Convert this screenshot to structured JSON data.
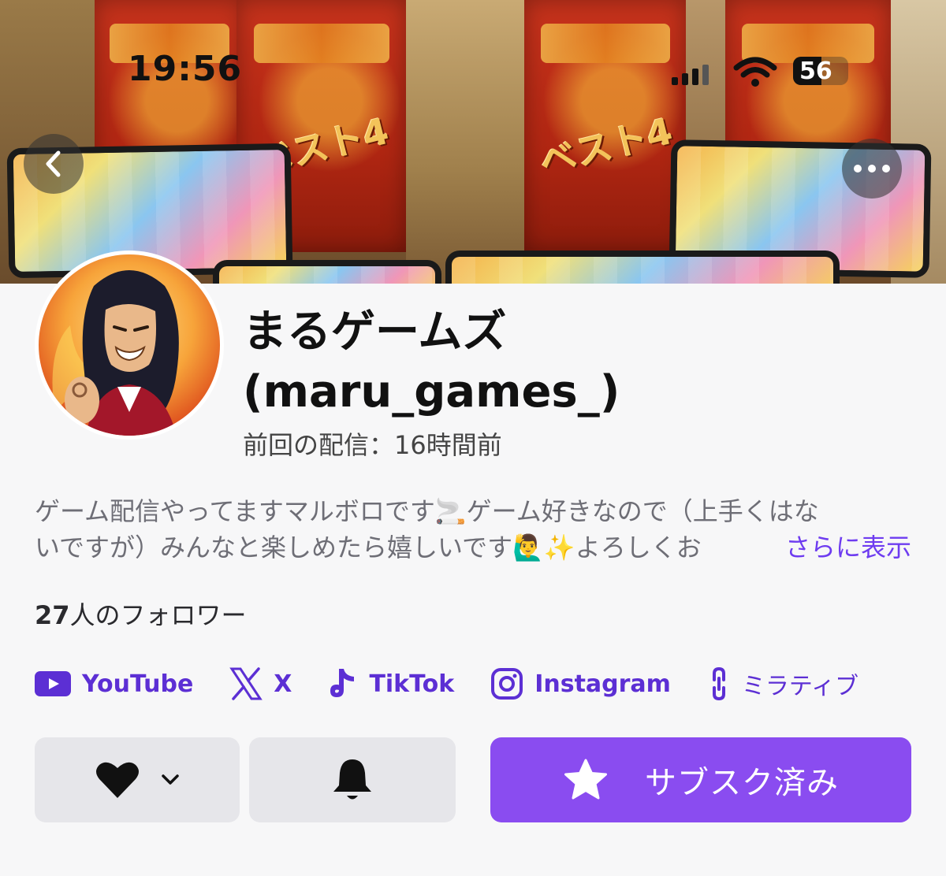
{
  "status_bar": {
    "time": "19:56",
    "battery": "56"
  },
  "banner": {
    "flag_text": "ベスト4"
  },
  "profile": {
    "display_name": "まるゲームズ",
    "login": "(maru_games_)",
    "last_stream": "前回の配信：16時間前",
    "bio_line1": "ゲーム配信やってますマルボロです🚬ゲーム好きなので（上手くはな",
    "bio_line2": "いですが）みんなと楽しめたら嬉しいです🙋‍♂️✨よろしくお",
    "show_more": "さらに表示",
    "followers_count": "27",
    "followers_suffix": "人のフォロワー"
  },
  "social_links": [
    {
      "name": "youtube",
      "label": "YouTube"
    },
    {
      "name": "x",
      "label": "X"
    },
    {
      "name": "tiktok",
      "label": "TikTok"
    },
    {
      "name": "instagram",
      "label": "Instagram"
    },
    {
      "name": "mirrativ",
      "label": "ミラティブ"
    }
  ],
  "actions": {
    "subscribe_label": "サブスク済み"
  },
  "colors": {
    "accent": "#8a4cf0",
    "link": "#5c2fd4"
  }
}
